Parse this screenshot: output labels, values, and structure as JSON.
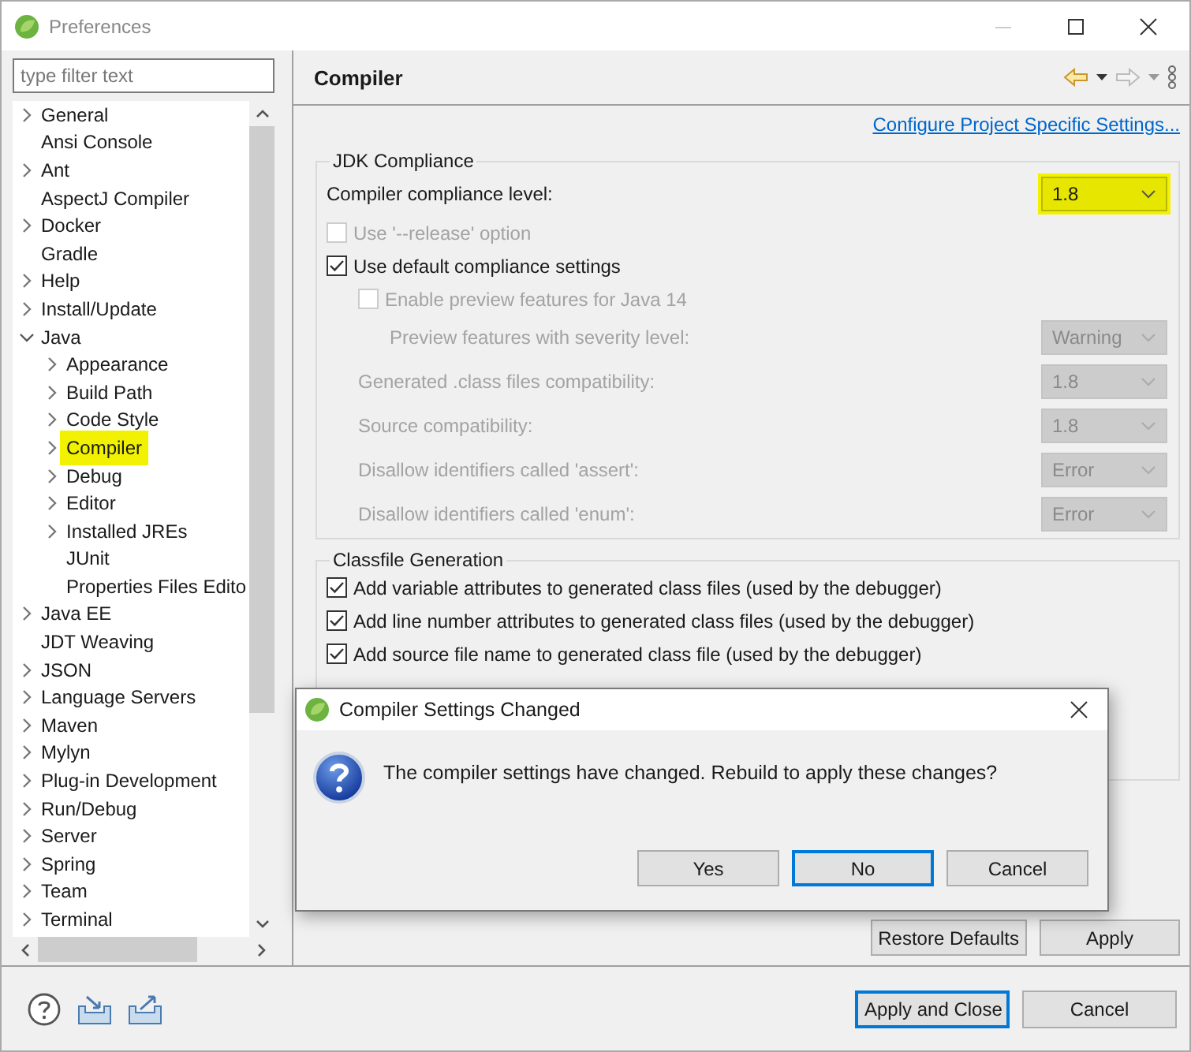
{
  "window": {
    "title": "Preferences"
  },
  "filter": {
    "placeholder": "type filter text"
  },
  "tree": [
    {
      "label": "General",
      "kind": "branch",
      "expanded": false,
      "highlighted": false
    },
    {
      "label": "Ansi Console",
      "kind": "leaf",
      "highlighted": false
    },
    {
      "label": "Ant",
      "kind": "branch",
      "expanded": false,
      "highlighted": false
    },
    {
      "label": "AspectJ Compiler",
      "kind": "leaf",
      "highlighted": false
    },
    {
      "label": "Docker",
      "kind": "branch",
      "expanded": false,
      "highlighted": false
    },
    {
      "label": "Gradle",
      "kind": "leaf",
      "highlighted": false
    },
    {
      "label": "Help",
      "kind": "branch",
      "expanded": false,
      "highlighted": false
    },
    {
      "label": "Install/Update",
      "kind": "branch",
      "expanded": false,
      "highlighted": false
    },
    {
      "label": "Java",
      "kind": "branch",
      "expanded": true,
      "highlighted": false,
      "children": [
        {
          "label": "Appearance",
          "kind": "branch",
          "expanded": false,
          "highlighted": false
        },
        {
          "label": "Build Path",
          "kind": "branch",
          "expanded": false,
          "highlighted": false
        },
        {
          "label": "Code Style",
          "kind": "branch",
          "expanded": false,
          "highlighted": false
        },
        {
          "label": "Compiler",
          "kind": "branch",
          "expanded": false,
          "highlighted": true
        },
        {
          "label": "Debug",
          "kind": "branch",
          "expanded": false,
          "highlighted": false
        },
        {
          "label": "Editor",
          "kind": "branch",
          "expanded": false,
          "highlighted": false
        },
        {
          "label": "Installed JREs",
          "kind": "branch",
          "expanded": false,
          "highlighted": false
        },
        {
          "label": "JUnit",
          "kind": "leaf",
          "highlighted": false
        },
        {
          "label": "Properties Files Edito",
          "kind": "leaf",
          "highlighted": false
        }
      ]
    },
    {
      "label": "Java EE",
      "kind": "branch",
      "expanded": false,
      "highlighted": false
    },
    {
      "label": "JDT Weaving",
      "kind": "leaf",
      "highlighted": false
    },
    {
      "label": "JSON",
      "kind": "branch",
      "expanded": false,
      "highlighted": false
    },
    {
      "label": "Language Servers",
      "kind": "branch",
      "expanded": false,
      "highlighted": false
    },
    {
      "label": "Maven",
      "kind": "branch",
      "expanded": false,
      "highlighted": false
    },
    {
      "label": "Mylyn",
      "kind": "branch",
      "expanded": false,
      "highlighted": false
    },
    {
      "label": "Plug-in Development",
      "kind": "branch",
      "expanded": false,
      "highlighted": false
    },
    {
      "label": "Run/Debug",
      "kind": "branch",
      "expanded": false,
      "highlighted": false
    },
    {
      "label": "Server",
      "kind": "branch",
      "expanded": false,
      "highlighted": false
    },
    {
      "label": "Spring",
      "kind": "branch",
      "expanded": false,
      "highlighted": false
    },
    {
      "label": "Team",
      "kind": "branch",
      "expanded": false,
      "highlighted": false
    },
    {
      "label": "Terminal",
      "kind": "branch",
      "expanded": false,
      "highlighted": false
    }
  ],
  "page": {
    "title": "Compiler",
    "link": "Configure Project Specific Settings...",
    "groups": [
      {
        "title": "JDK Compliance",
        "rows": [
          {
            "kind": "select",
            "label": "Compiler compliance level:",
            "value": "1.8",
            "disabled": false,
            "highlighted": true
          },
          {
            "kind": "checkbox",
            "label": "Use '--release' option",
            "checked": false,
            "disabled": true
          },
          {
            "kind": "checkbox",
            "label": "Use default compliance settings",
            "checked": true,
            "disabled": false,
            "children": [
              {
                "kind": "checkbox",
                "label": "Enable preview features for Java 14",
                "checked": false,
                "disabled": true,
                "children": [
                  {
                    "kind": "select",
                    "label": "Preview features with severity level:",
                    "value": "Warning",
                    "disabled": true,
                    "highlighted": false
                  }
                ]
              },
              {
                "kind": "select",
                "label": "Generated .class files compatibility:",
                "value": "1.8",
                "disabled": true,
                "highlighted": false
              },
              {
                "kind": "select",
                "label": "Source compatibility:",
                "value": "1.8",
                "disabled": true,
                "highlighted": false
              },
              {
                "kind": "select",
                "label": "Disallow identifiers called 'assert':",
                "value": "Error",
                "disabled": true,
                "highlighted": false
              },
              {
                "kind": "select",
                "label": "Disallow identifiers called 'enum':",
                "value": "Error",
                "disabled": true,
                "highlighted": false
              }
            ]
          }
        ]
      },
      {
        "title": "Classfile Generation",
        "rows": [
          {
            "kind": "checkbox",
            "label": "Add variable attributes to generated class files (used by the debugger)",
            "checked": true,
            "disabled": false
          },
          {
            "kind": "checkbox",
            "label": "Add line number attributes to generated class files (used by the debugger)",
            "checked": true,
            "disabled": false
          },
          {
            "kind": "checkbox",
            "label": "Add source file name to generated class file (used by the debugger)",
            "checked": true,
            "disabled": false
          }
        ]
      }
    ],
    "buttons": [
      {
        "label": "Restore Defaults",
        "default": false
      },
      {
        "label": "Apply",
        "default": false
      }
    ]
  },
  "footer": {
    "buttons": [
      {
        "label": "Apply and Close",
        "default": true
      },
      {
        "label": "Cancel",
        "default": false
      }
    ]
  },
  "dialog": {
    "title": "Compiler Settings Changed",
    "message": "The compiler settings have changed. Rebuild to apply these changes?",
    "buttons": [
      {
        "label": "Yes",
        "default": false
      },
      {
        "label": "No",
        "default": true
      },
      {
        "label": "Cancel",
        "default": false
      }
    ]
  }
}
